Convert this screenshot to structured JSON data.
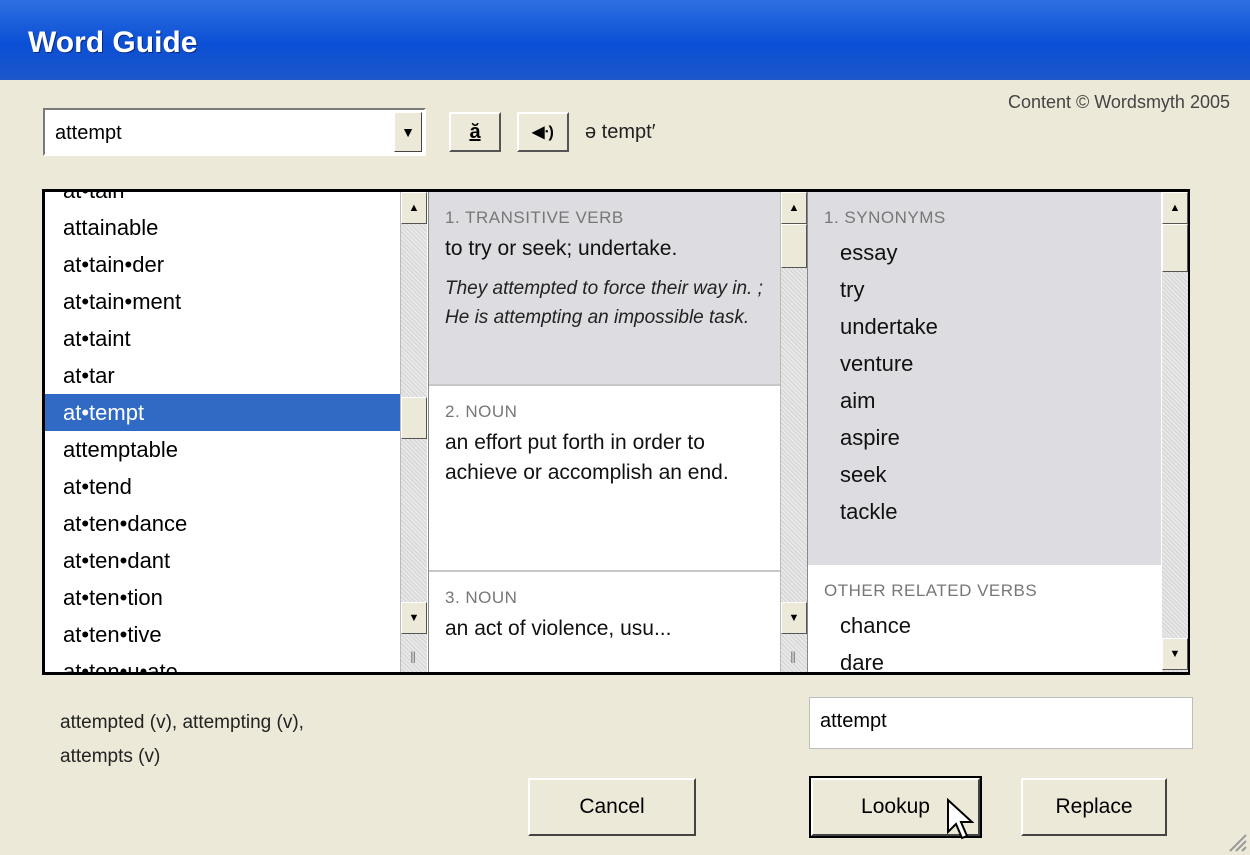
{
  "window": {
    "title": "Word Guide"
  },
  "credit": "Content © Wordsmyth 2005",
  "search": {
    "value": "attempt"
  },
  "toolbar": {
    "pronunciation_glyph": "ă",
    "sound_glyph": "◀ᐧ)",
    "pronunciation": "ə tempt′"
  },
  "word_list": [
    "at•tain",
    "attainable",
    "at•tain•der",
    "at•tain•ment",
    "at•taint",
    "at•tar",
    "at•tempt",
    "attemptable",
    "at•tend",
    "at•ten•dance",
    "at•ten•dant",
    "at•ten•tion",
    "at•ten•tive",
    "at•ten•u•ate"
  ],
  "selected_word": "at•tempt",
  "definitions": [
    {
      "heading": "1. TRANSITIVE VERB",
      "text": "to try or seek; undertake.",
      "example": "They attempted to force their way in. ; He is attempting an impossible task."
    },
    {
      "heading": "2. NOUN",
      "text": "an effort put forth in order to achieve or accomplish an end."
    },
    {
      "heading": "3. NOUN",
      "text": "an act of violence, usu..."
    }
  ],
  "synonyms": {
    "heading": "1. SYNONYMS",
    "items": [
      "essay",
      "try",
      "undertake",
      "venture",
      "aim",
      "aspire",
      "seek",
      "tackle"
    ],
    "related_heading": "OTHER RELATED VERBS",
    "related_items": [
      "chance",
      "dare"
    ]
  },
  "forms": {
    "line1": "attempted (v), attempting (v),",
    "line2": "attempts (v)"
  },
  "lookup_field": {
    "value": "attempt"
  },
  "buttons": {
    "cancel": "Cancel",
    "lookup": "Lookup",
    "replace": "Replace"
  }
}
